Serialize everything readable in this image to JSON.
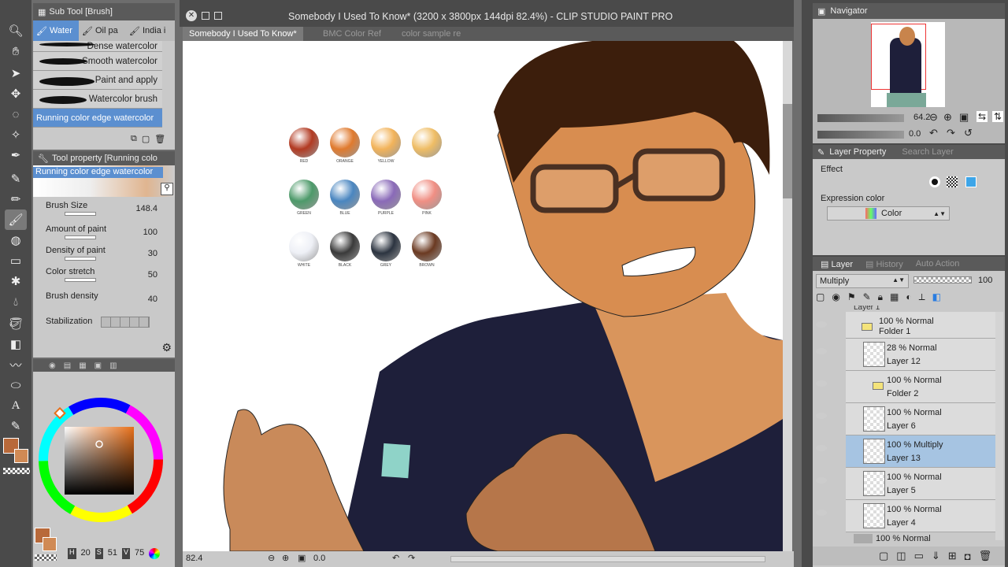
{
  "window": {
    "title": "Somebody I Used To Know* (3200 x 3800px 144dpi 82.4%)  - CLIP STUDIO PAINT PRO"
  },
  "doc_tabs": [
    "Somebody I Used To Know*",
    "BMC Color Ref",
    "color sample re"
  ],
  "sub_tool": {
    "header": "Sub Tool [Brush]",
    "tabs": [
      "Water",
      "Oil pa",
      "India i"
    ],
    "brushes": [
      "Dense watercolor",
      "Smooth watercolor",
      "Paint and apply",
      "Watercolor brush",
      "Running color edge watercolor"
    ]
  },
  "tool_property": {
    "header": "Tool property [Running colo",
    "brush_name": "Running color edge watercolor",
    "rows": [
      {
        "label": "Brush Size",
        "value": "148.4"
      },
      {
        "label": "Amount of paint",
        "value": "100"
      },
      {
        "label": "Density of paint",
        "value": "30"
      },
      {
        "label": "Color stretch",
        "value": "50"
      },
      {
        "label": "Brush density",
        "value": "40"
      }
    ],
    "stabilization_label": "Stabilization"
  },
  "color": {
    "main_hex": "#b8693a",
    "sub_hex": "#d08a55",
    "hue_ring": true,
    "readout": {
      "h_label": "H",
      "h_value": "20",
      "s_label": "S",
      "s_value": "51",
      "v_label": "V",
      "v_value": "75"
    }
  },
  "canvas": {
    "zoom": "82.4",
    "angle": "0.0",
    "swatch_labels": [
      "RED",
      "ORANGE",
      "YELLOW",
      "",
      "GREEN",
      "BLUE",
      "PURPLE",
      "PINK",
      "WHITE",
      "BLACK",
      "GREY",
      "BROWN"
    ],
    "swatch_colors": [
      "#b23a22",
      "#e07a2e",
      "#f2b35a",
      "#efbd65",
      "#4d9a6a",
      "#4a86c0",
      "#8a6ab8",
      "#f08f84",
      "#eef0f6",
      "#3a3a3a",
      "#2c3440",
      "#6b3a22"
    ]
  },
  "navigator": {
    "header": "Navigator",
    "zoom": "64.2",
    "angle": "0.0"
  },
  "layer_property": {
    "header": "Layer Property",
    "header2": "Search Layer",
    "effect_label": "Effect",
    "expression_label": "Expression color",
    "expression_value": "Color"
  },
  "layer_panel": {
    "tabs": [
      "Layer",
      "History",
      "Auto Action"
    ],
    "blend_mode": "Multiply",
    "opacity": "100",
    "top_partial": "Layer 1",
    "layers": [
      {
        "mode": "100 % Normal",
        "name": "Folder 1",
        "type": "folder"
      },
      {
        "mode": "28 % Normal",
        "name": "Layer 12",
        "type": "layer"
      },
      {
        "mode": "100 % Normal",
        "name": "Folder 2",
        "type": "folder"
      },
      {
        "mode": "100 % Normal",
        "name": "Layer 6",
        "type": "layer"
      },
      {
        "mode": "100 % Multiply",
        "name": "Layer 13",
        "type": "layer",
        "selected": true
      },
      {
        "mode": "100 % Normal",
        "name": "Layer 5",
        "type": "layer"
      },
      {
        "mode": "100 % Normal",
        "name": "Layer 4",
        "type": "layer"
      }
    ],
    "bottom_partial": "100 % Normal"
  }
}
